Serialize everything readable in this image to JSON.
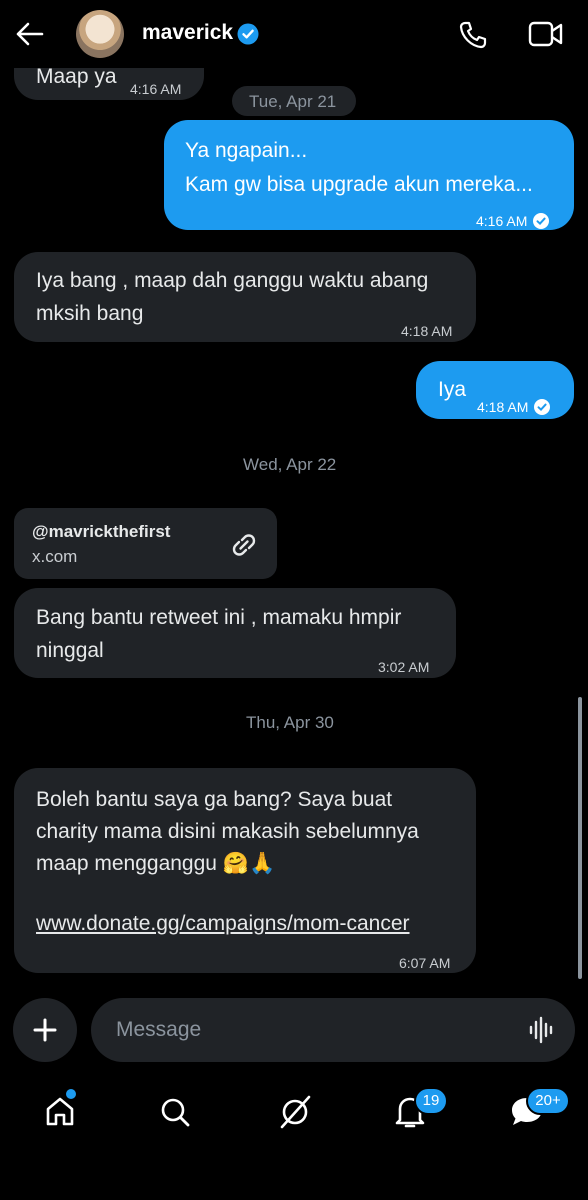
{
  "header": {
    "name": "maverick",
    "back_icon": "arrow-left-icon",
    "call_icon": "phone-icon",
    "video_icon": "video-icon"
  },
  "messages": {
    "m0": {
      "text": "Maap ya",
      "time": "4:16 AM"
    },
    "d1": "Tue, Apr 21",
    "m1": {
      "line1": "Ya ngapain...",
      "line2": "Kam gw bisa upgrade akun mereka...",
      "time": "4:16 AM"
    },
    "m2": {
      "line1": "Iya bang , maap dah ganggu waktu abang",
      "line2": "mksih bang",
      "time": "4:18 AM"
    },
    "m3": {
      "text": "Iya",
      "time": "4:18 AM"
    },
    "d2": "Wed, Apr 22",
    "link": {
      "handle": "@mavrickthefirst",
      "domain": "x.com"
    },
    "m4": {
      "line1": "Bang bantu retweet ini , mamaku hmpir",
      "line2": "ninggal",
      "time": "3:02 AM"
    },
    "d3": "Thu, Apr 30",
    "m5": {
      "line1": "Boleh bantu saya ga bang? Saya buat",
      "line2": "charity mama disini makasih sebelumnya",
      "line3": "maap mengganggu 🤗🙏",
      "url": "www.donate.gg/campaigns/mom-cancer",
      "time": "6:07 AM"
    }
  },
  "composer": {
    "placeholder": "Message"
  },
  "nav": {
    "notifications_badge": "19",
    "messages_badge": "20+"
  },
  "colors": {
    "accent": "#1d9bf0",
    "bubble_in": "#202327",
    "background": "#000000"
  }
}
